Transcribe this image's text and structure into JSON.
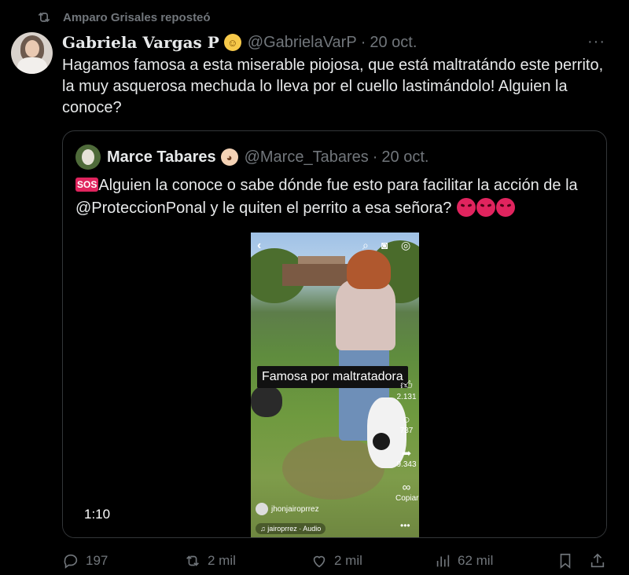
{
  "repost": {
    "text": "Amparo Grisales reposteó",
    "icon": "repost-icon"
  },
  "post": {
    "author_name": "Gabriela Vargas P",
    "author_emoji": "baby-emoji",
    "handle": "@GabrielaVarP",
    "separator": "·",
    "time": "20 oct.",
    "more": "···",
    "text": "Hagamos famosa a esta miserable piojosa, que está maltratándo este perrito, la muy asquerosa mechuda lo lleva por el cuello lastimándolo! Alguien la conoce?"
  },
  "quote": {
    "author_name": "Marce Tabares",
    "author_emoji": "dog-face-emoji",
    "handle": "@Marce_Tabares",
    "separator": "·",
    "time": "20 oct.",
    "sos": "SOS",
    "text": "Alguien la conoce o sabe dónde fue esto para facilitar la acción de la @ProteccionPonal y le quiten el perrito a esa señora?",
    "trailing_emoji": [
      "angry-face-emoji",
      "angry-face-emoji",
      "angry-face-emoji"
    ],
    "video": {
      "duration": "1:10",
      "caption": "Famosa por maltratadora",
      "likes": "2.131",
      "comments": "737",
      "shares": "9.343",
      "copy_label": "Copiar",
      "account": "jhonjairoprrez",
      "audio": "jairoprrez · Audio"
    }
  },
  "actions": {
    "replies": "197",
    "reposts": "2 mil",
    "likes": "2 mil",
    "views": "62 mil"
  },
  "colors": {
    "background": "#000000",
    "text": "#e7e9ea",
    "muted": "#71767b",
    "border": "#333639"
  }
}
